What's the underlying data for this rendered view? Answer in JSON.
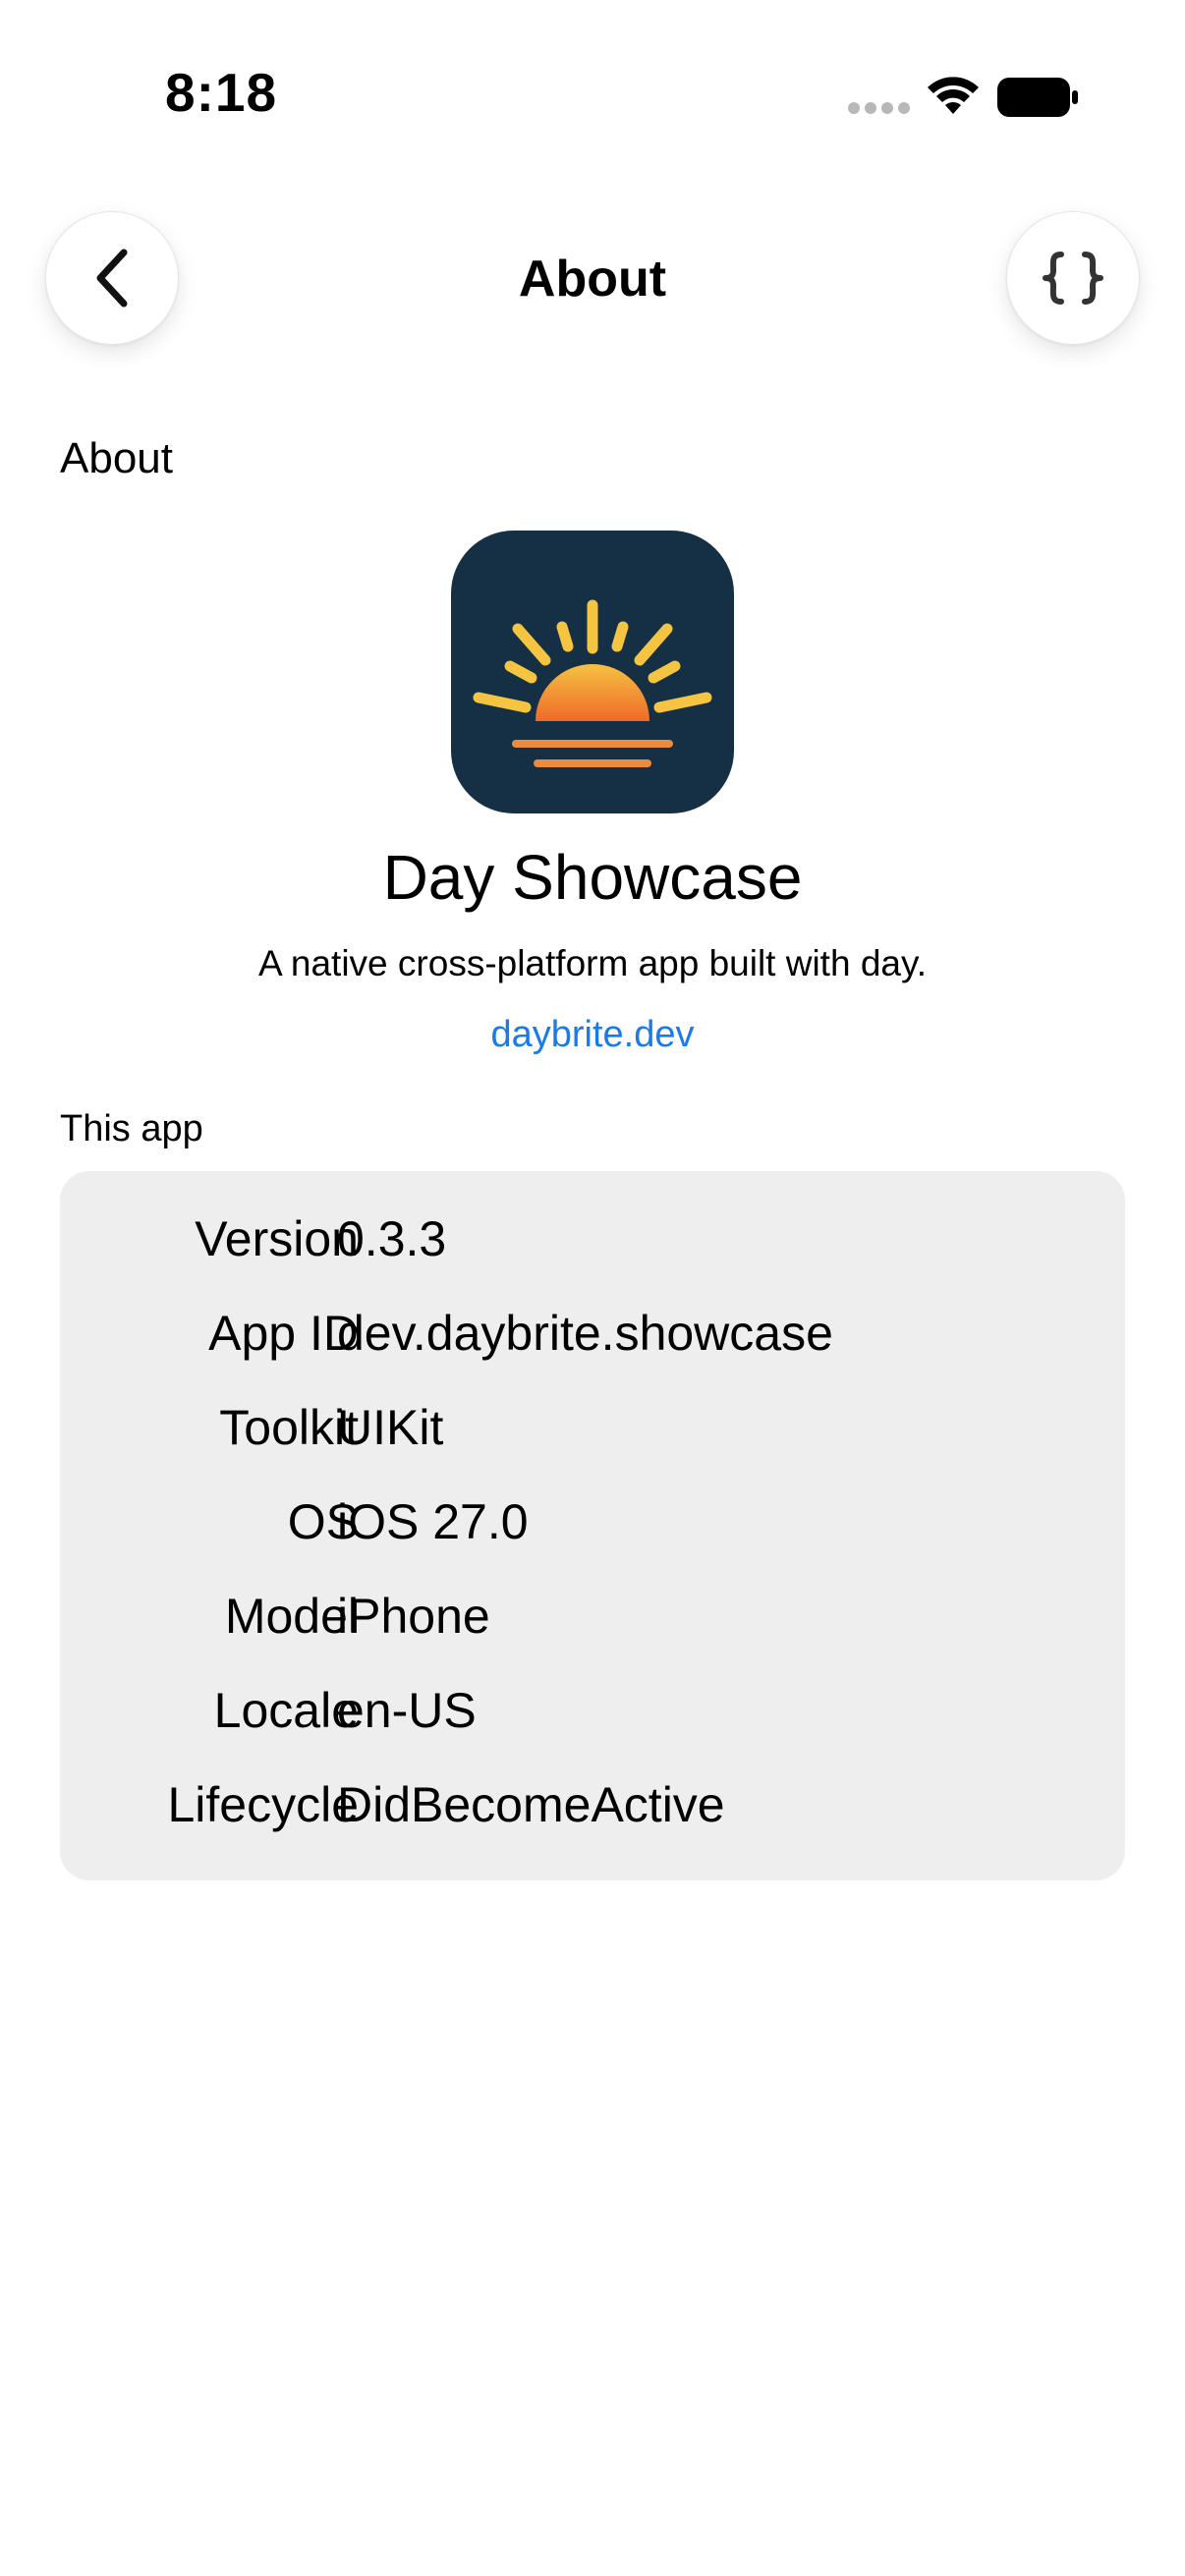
{
  "status_bar": {
    "time": "8:18"
  },
  "nav": {
    "title": "About",
    "back_icon": "chevron-left-icon",
    "right_icon": "curly-braces-icon"
  },
  "section": {
    "title": "About"
  },
  "app": {
    "name": "Day Showcase",
    "tagline": "A native cross-platform app built with day.",
    "link": "daybrite.dev",
    "icon": "sunrise-app-icon"
  },
  "info": {
    "header": "This app",
    "rows": [
      {
        "label": "Version",
        "value": "0.3.3"
      },
      {
        "label": "App ID",
        "value": "dev.daybrite.showcase"
      },
      {
        "label": "Toolkit",
        "value": "UIKit"
      },
      {
        "label": "OS",
        "value": "iOS 27.0"
      },
      {
        "label": "Model",
        "value": "iPhone"
      },
      {
        "label": "Locale",
        "value": "en-US"
      },
      {
        "label": "Lifecycle",
        "value": "DidBecomeActive"
      }
    ]
  },
  "colors": {
    "link": "#1a7be8",
    "card_background": "#eeeeee",
    "icon_background": "#153044",
    "sun_top": "#f5c242",
    "sun_bottom": "#ef6a2a"
  }
}
